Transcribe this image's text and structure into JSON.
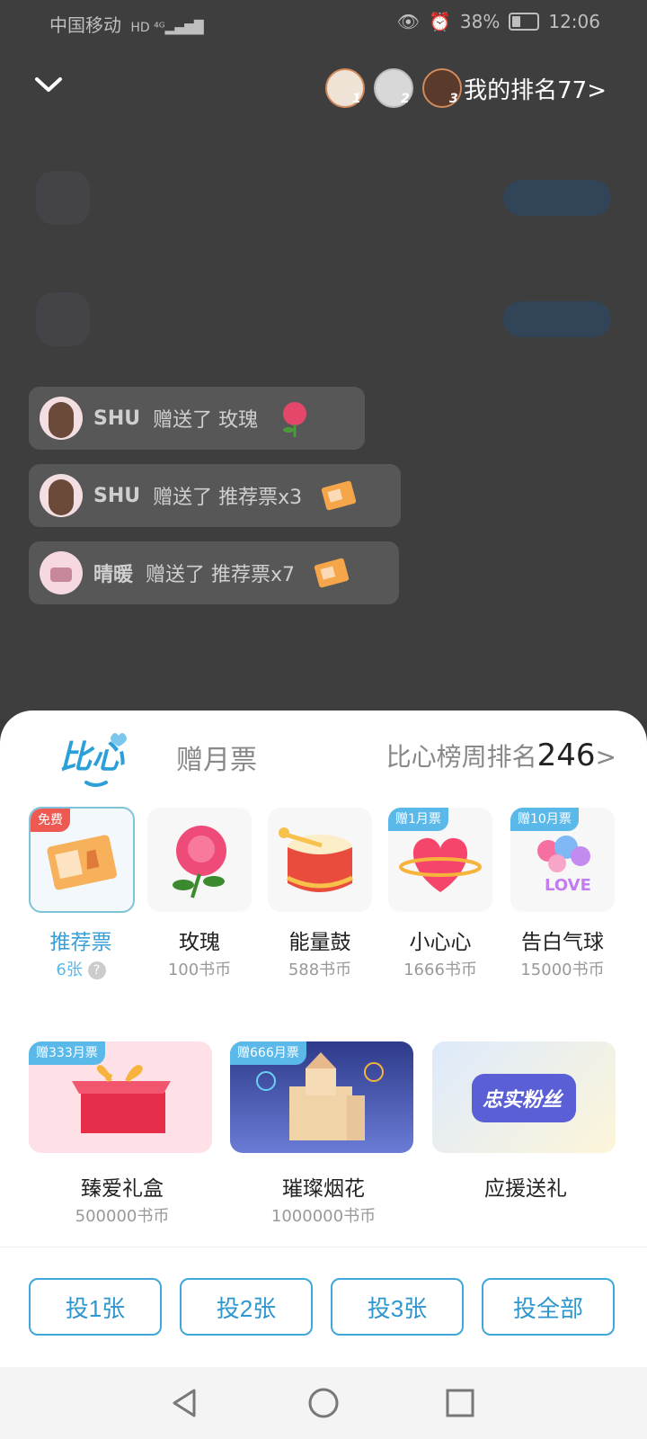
{
  "status_bar": {
    "carrier": "中国移动",
    "battery": "38%",
    "time": "12:06"
  },
  "header": {
    "my_rank_label": "我的排名77>",
    "rank_numbers": [
      "1",
      "2",
      "3"
    ]
  },
  "gift_feed": [
    {
      "user": "SHU",
      "text": "赠送了 玫瑰"
    },
    {
      "user": "SHU",
      "text": "赠送了 推荐票x3"
    },
    {
      "user": "晴暖",
      "text": "赠送了 推荐票x7"
    }
  ],
  "sheet": {
    "tab_yuepiao": "赠月票",
    "week_rank_label": "比心榜周排名",
    "week_rank_value": "246",
    "week_rank_arrow": ">",
    "gifts": [
      {
        "tag": "免费",
        "name": "推荐票",
        "price": "6张",
        "selected": true
      },
      {
        "tag": "",
        "name": "玫瑰",
        "price": "100书币"
      },
      {
        "tag": "",
        "name": "能量鼓",
        "price": "588书币"
      },
      {
        "tag": "赠1月票",
        "name": "小心心",
        "price": "1666书币"
      },
      {
        "tag": "赠10月票",
        "name": "告白气球",
        "price": "15000书币"
      }
    ],
    "big_gifts": [
      {
        "tag": "赠333月票",
        "name": "臻爱礼盒",
        "price": "500000书币"
      },
      {
        "tag": "赠666月票",
        "name": "璀璨烟花",
        "price": "1000000书币"
      },
      {
        "tag": "",
        "name": "应援送礼",
        "price": "",
        "badge": "忠实粉丝"
      }
    ],
    "vote_buttons": [
      "投1张",
      "投2张",
      "投3张",
      "投全部"
    ],
    "logo_text": "比心",
    "question_mark": "?",
    "balloon_text": "LOVE"
  },
  "colors": {
    "accent": "#3a9fd6",
    "tag_red": "#ee5a52",
    "tag_blue": "#5bb9ea"
  }
}
